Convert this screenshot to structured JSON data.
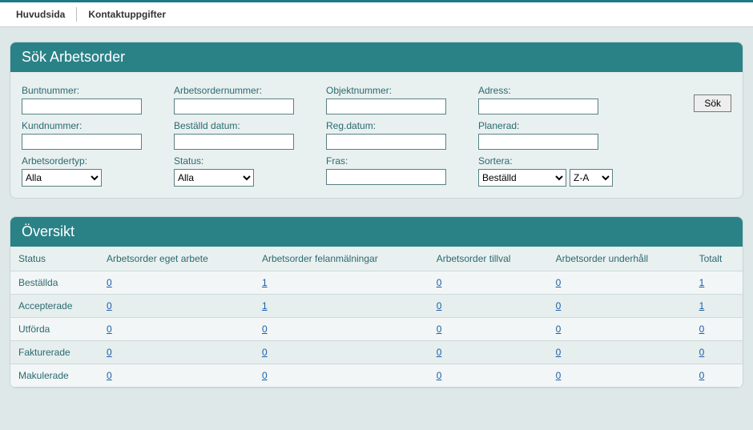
{
  "nav": {
    "home": "Huvudsida",
    "contact": "Kontaktuppgifter"
  },
  "search": {
    "title": "Sök Arbetsorder",
    "labels": {
      "buntnummer": "Buntnummer:",
      "kundnummer": "Kundnummer:",
      "arbetsordertyp": "Arbetsordertyp:",
      "arbetsordernummer": "Arbetsordernummer:",
      "bestalld_datum": "Beställd datum:",
      "status": "Status:",
      "objektnummer": "Objektnummer:",
      "reg_datum": "Reg.datum:",
      "fras": "Fras:",
      "adress": "Adress:",
      "planerad": "Planerad:",
      "sortera": "Sortera:"
    },
    "values": {
      "buntnummer": "",
      "kundnummer": "",
      "arbetsordertyp": "Alla",
      "arbetsordernummer": "",
      "bestalld_datum": "",
      "status": "Alla",
      "objektnummer": "",
      "reg_datum": "",
      "fras": "",
      "adress": "",
      "planerad": "",
      "sortera": "Beställd",
      "sort_dir": "Z-A"
    },
    "button": "Sök"
  },
  "overview": {
    "title": "Översikt",
    "headers": {
      "status": "Status",
      "eget": "Arbetsorder eget arbete",
      "fel": "Arbetsorder felanmälningar",
      "tillval": "Arbetsorder tillval",
      "underhall": "Arbetsorder underhåll",
      "totalt": "Totalt"
    },
    "rows": [
      {
        "status": "Beställda",
        "eget": "0",
        "fel": "1",
        "tillval": "0",
        "underhall": "0",
        "totalt": "1"
      },
      {
        "status": "Accepterade",
        "eget": "0",
        "fel": "1",
        "tillval": "0",
        "underhall": "0",
        "totalt": "1"
      },
      {
        "status": "Utförda",
        "eget": "0",
        "fel": "0",
        "tillval": "0",
        "underhall": "0",
        "totalt": "0"
      },
      {
        "status": "Fakturerade",
        "eget": "0",
        "fel": "0",
        "tillval": "0",
        "underhall": "0",
        "totalt": "0"
      },
      {
        "status": "Makulerade",
        "eget": "0",
        "fel": "0",
        "tillval": "0",
        "underhall": "0",
        "totalt": "0"
      }
    ]
  }
}
